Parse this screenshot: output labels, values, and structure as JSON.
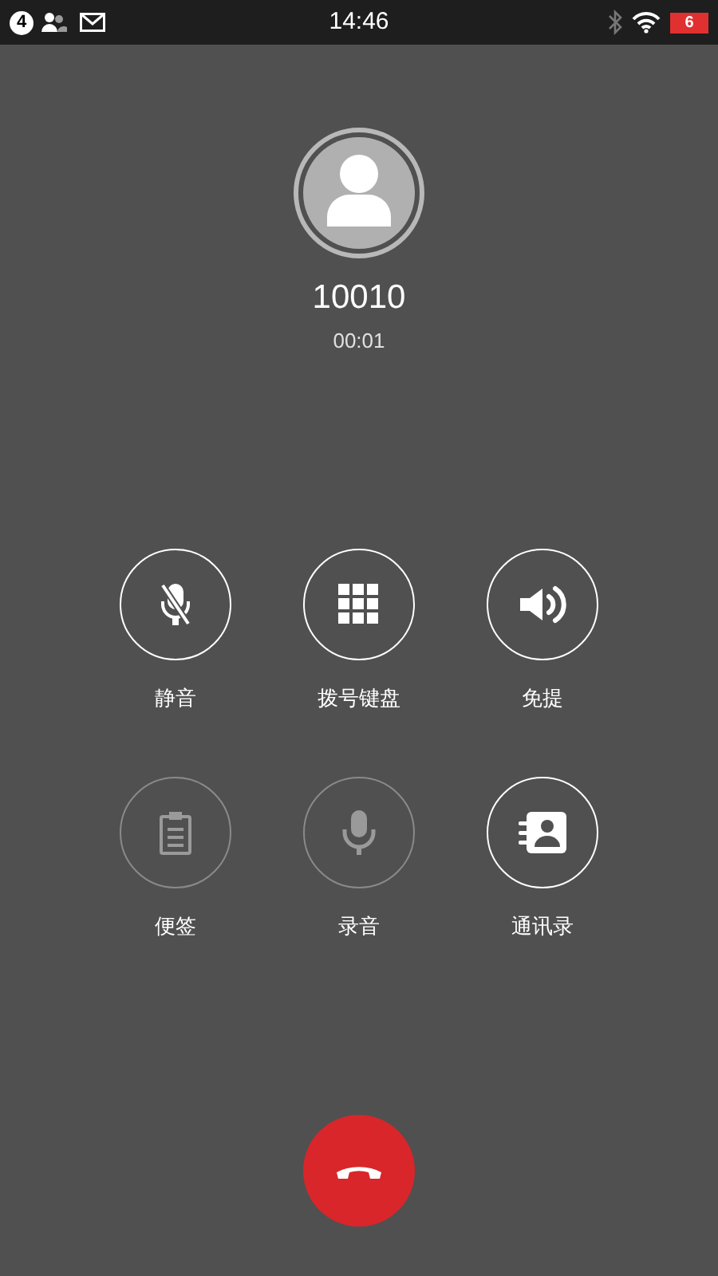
{
  "status_bar": {
    "notification_count": "4",
    "time": "14:46",
    "battery": "6"
  },
  "call": {
    "number": "10010",
    "duration": "00:01"
  },
  "actions": [
    {
      "kind": "mute",
      "label": "静音",
      "disabled": false
    },
    {
      "kind": "keypad",
      "label": "拨号键盘",
      "disabled": false
    },
    {
      "kind": "speaker",
      "label": "免提",
      "disabled": false
    },
    {
      "kind": "note",
      "label": "便签",
      "disabled": true
    },
    {
      "kind": "record",
      "label": "录音",
      "disabled": true
    },
    {
      "kind": "contacts",
      "label": "通讯录",
      "disabled": false
    }
  ]
}
